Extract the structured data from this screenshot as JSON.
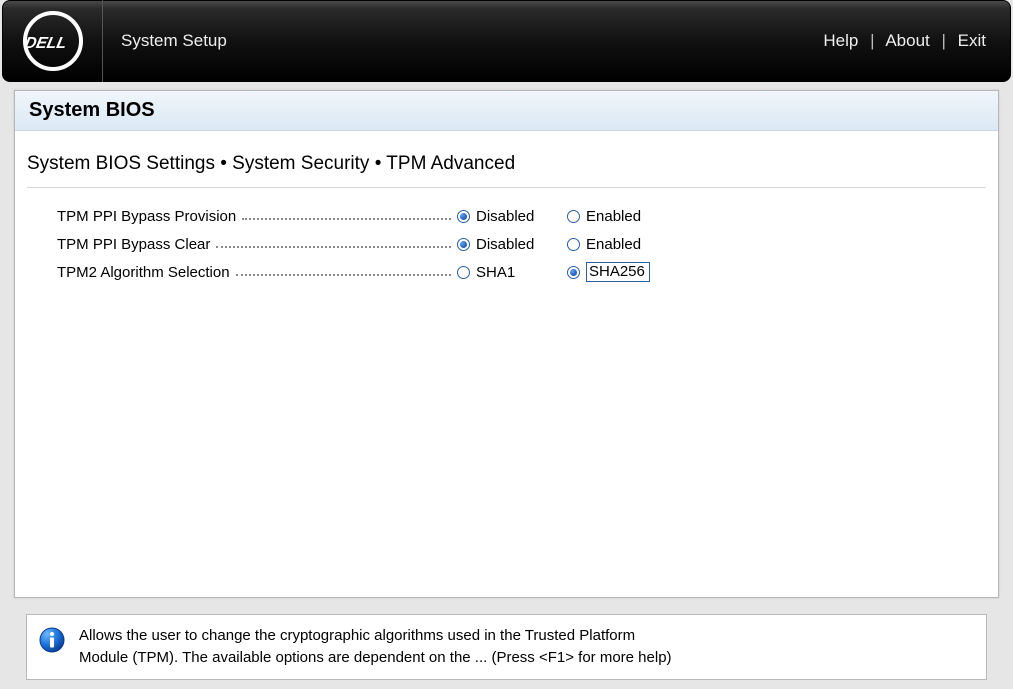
{
  "header": {
    "app_title": "System Setup",
    "links": {
      "help": "Help",
      "about": "About",
      "exit": "Exit"
    }
  },
  "panel": {
    "title": "System BIOS",
    "breadcrumb": "System BIOS Settings • System Security • TPM Advanced"
  },
  "settings": [
    {
      "label": "TPM PPI Bypass Provision",
      "options": [
        {
          "label": "Disabled",
          "selected": true
        },
        {
          "label": "Enabled",
          "selected": false
        }
      ]
    },
    {
      "label": "TPM PPI Bypass Clear",
      "options": [
        {
          "label": "Disabled",
          "selected": true
        },
        {
          "label": "Enabled",
          "selected": false
        }
      ]
    },
    {
      "label": "TPM2 Algorithm Selection",
      "options": [
        {
          "label": "SHA1",
          "selected": false
        },
        {
          "label": "SHA256",
          "selected": true,
          "focused": true
        }
      ]
    }
  ],
  "help": {
    "line1": "Allows the user to change the cryptographic algorithms used in the Trusted Platform",
    "line2": "Module (TPM). The available options are dependent on the ... (Press <F1> for more help)"
  }
}
